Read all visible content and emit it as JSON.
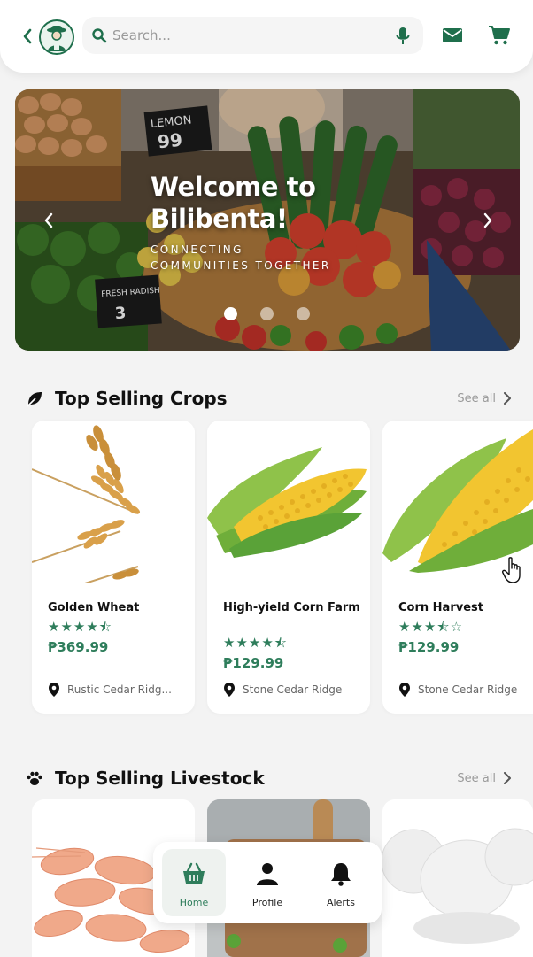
{
  "header": {
    "search": {
      "placeholder": "Search..."
    }
  },
  "banner": {
    "title_line1": "Welcome to",
    "title_line2": "Bilibenta!",
    "subtitle_line1": "CONNECTING",
    "subtitle_line2": "COMMUNITIES TOGETHER",
    "sign_lemon": "LEMON",
    "sign_lemon_price": "99",
    "sign_radish": "FRESH RADISH",
    "sign_radish_price": "3",
    "slide_count": 3,
    "active_slide": 1
  },
  "sections": {
    "crops": {
      "title": "Top Selling Crops",
      "see_all": "See all",
      "icon": "leaf-icon",
      "items": [
        {
          "name": "Golden Wheat",
          "rating": 4.5,
          "price": "₱369.99",
          "location": "Rustic Cedar Ridg...",
          "image": "wheat"
        },
        {
          "name": "High-yield Corn Farm",
          "rating": 4.5,
          "price": "₱129.99",
          "location": "Stone Cedar Ridge",
          "image": "corn"
        },
        {
          "name": "Corn Harvest",
          "rating": 3.5,
          "price": "₱129.99",
          "location": "Stone Cedar Ridge",
          "image": "corn"
        }
      ]
    },
    "livestock": {
      "title": "Top Selling Livestock",
      "see_all": "See all",
      "icon": "paw-icon",
      "items": [
        {
          "image": "shrimp"
        },
        {
          "image": "cutting-board"
        },
        {
          "image": "eggs"
        }
      ]
    }
  },
  "nav": {
    "items": [
      {
        "label": "Home",
        "icon": "basket-icon",
        "active": true
      },
      {
        "label": "Profile",
        "icon": "person-icon",
        "active": false
      },
      {
        "label": "Alerts",
        "icon": "bell-icon",
        "active": false
      }
    ]
  },
  "colors": {
    "brand": "#2e7d5b",
    "brand_dark": "#1f6f4c",
    "background": "#f3f3f3"
  }
}
